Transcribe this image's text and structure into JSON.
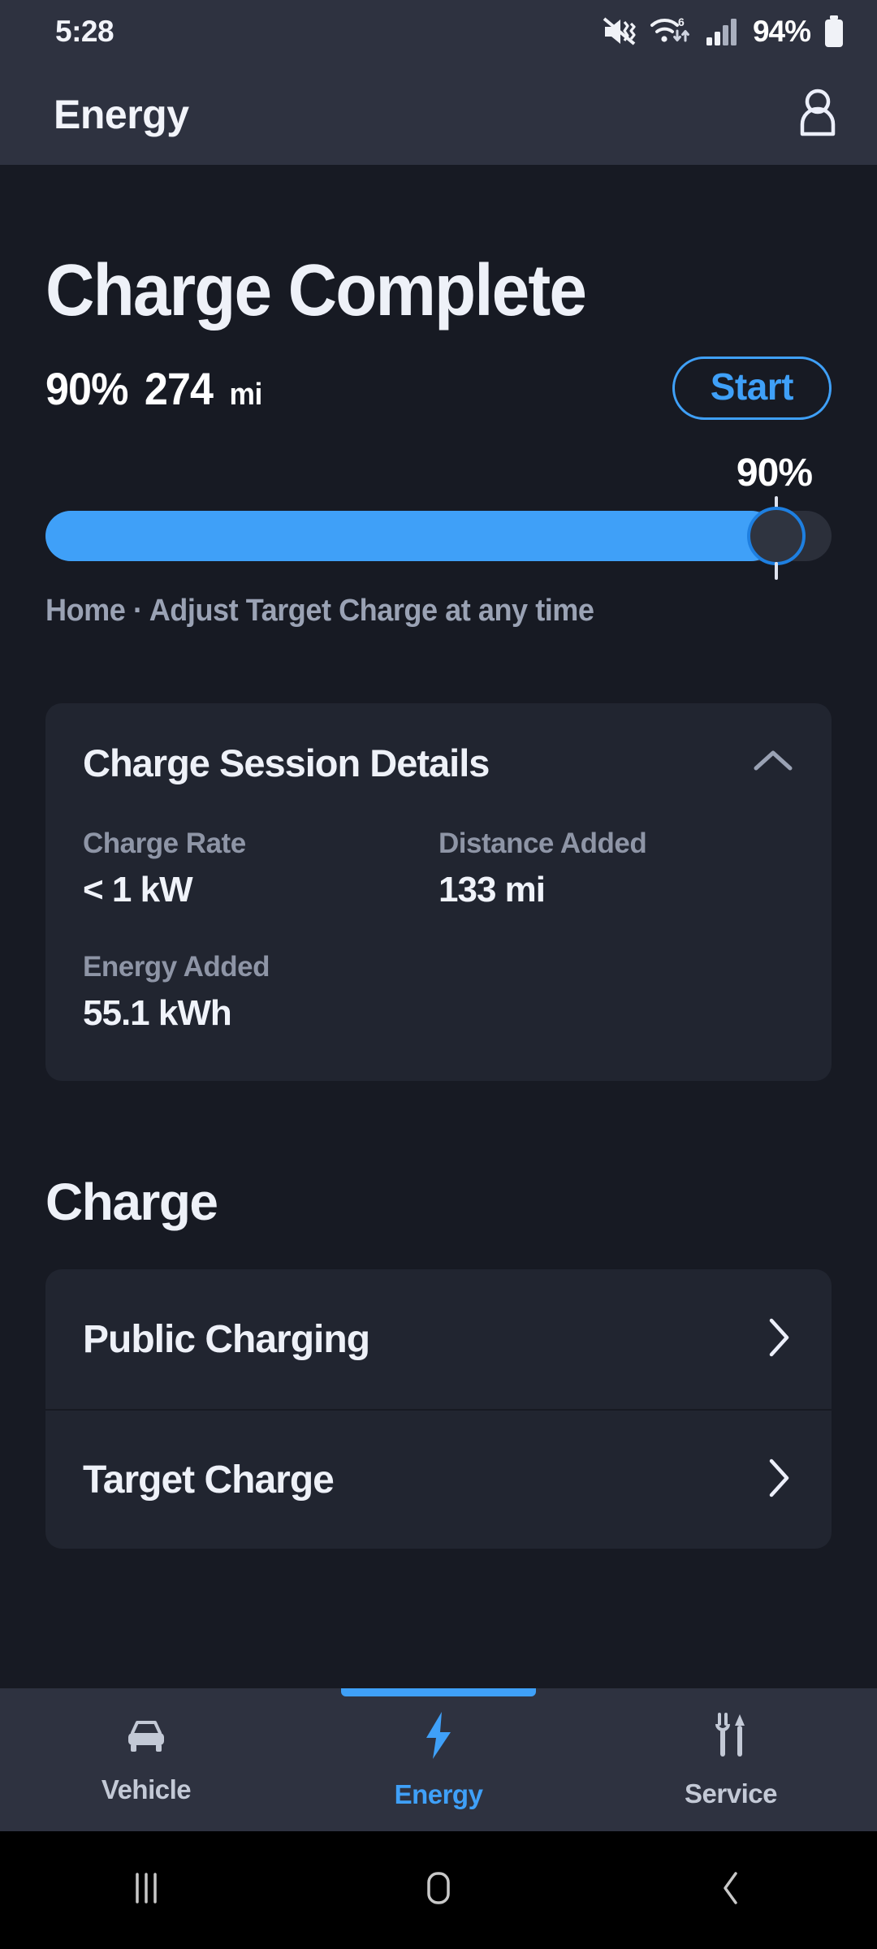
{
  "status_bar": {
    "time": "5:28",
    "battery_percent": "94%",
    "icons": [
      "mute-vibrate-icon",
      "wifi-6-icon",
      "cellular-signal-icon",
      "battery-icon"
    ]
  },
  "app_bar": {
    "title": "Energy",
    "account_icon": "person-icon"
  },
  "hero": {
    "title": "Charge Complete",
    "battery_percent": "90%",
    "range_value": "274",
    "range_unit": "mi",
    "start_label": "Start"
  },
  "slider": {
    "value_label": "90%",
    "value": 90,
    "min": 0,
    "max": 100,
    "caption": "Home · Adjust Target Charge at any time",
    "fill_color": "#3fa0f8",
    "track_color": "#2b2f3a"
  },
  "session_card": {
    "title": "Charge Session Details",
    "collapse_icon": "chevron-up-icon",
    "metrics": [
      {
        "label": "Charge Rate",
        "value": "< 1 kW"
      },
      {
        "label": "Distance Added",
        "value": "133 mi"
      },
      {
        "label": "Energy Added",
        "value": "55.1 kWh"
      }
    ]
  },
  "charge_section": {
    "title": "Charge",
    "items": [
      {
        "label": "Public Charging",
        "chevron": "chevron-right-icon"
      },
      {
        "label": "Target Charge",
        "chevron": "chevron-right-icon"
      }
    ]
  },
  "bottom_nav": {
    "active_color": "#3fa0f8",
    "inactive_color": "#c3c9d6",
    "items": [
      {
        "label": "Vehicle",
        "icon": "car-icon",
        "active": false
      },
      {
        "label": "Energy",
        "icon": "lightning-bolt-icon",
        "active": true
      },
      {
        "label": "Service",
        "icon": "wrench-screwdriver-icon",
        "active": false
      }
    ]
  },
  "android_nav": {
    "buttons": [
      "recents-icon",
      "home-icon",
      "back-icon"
    ]
  }
}
